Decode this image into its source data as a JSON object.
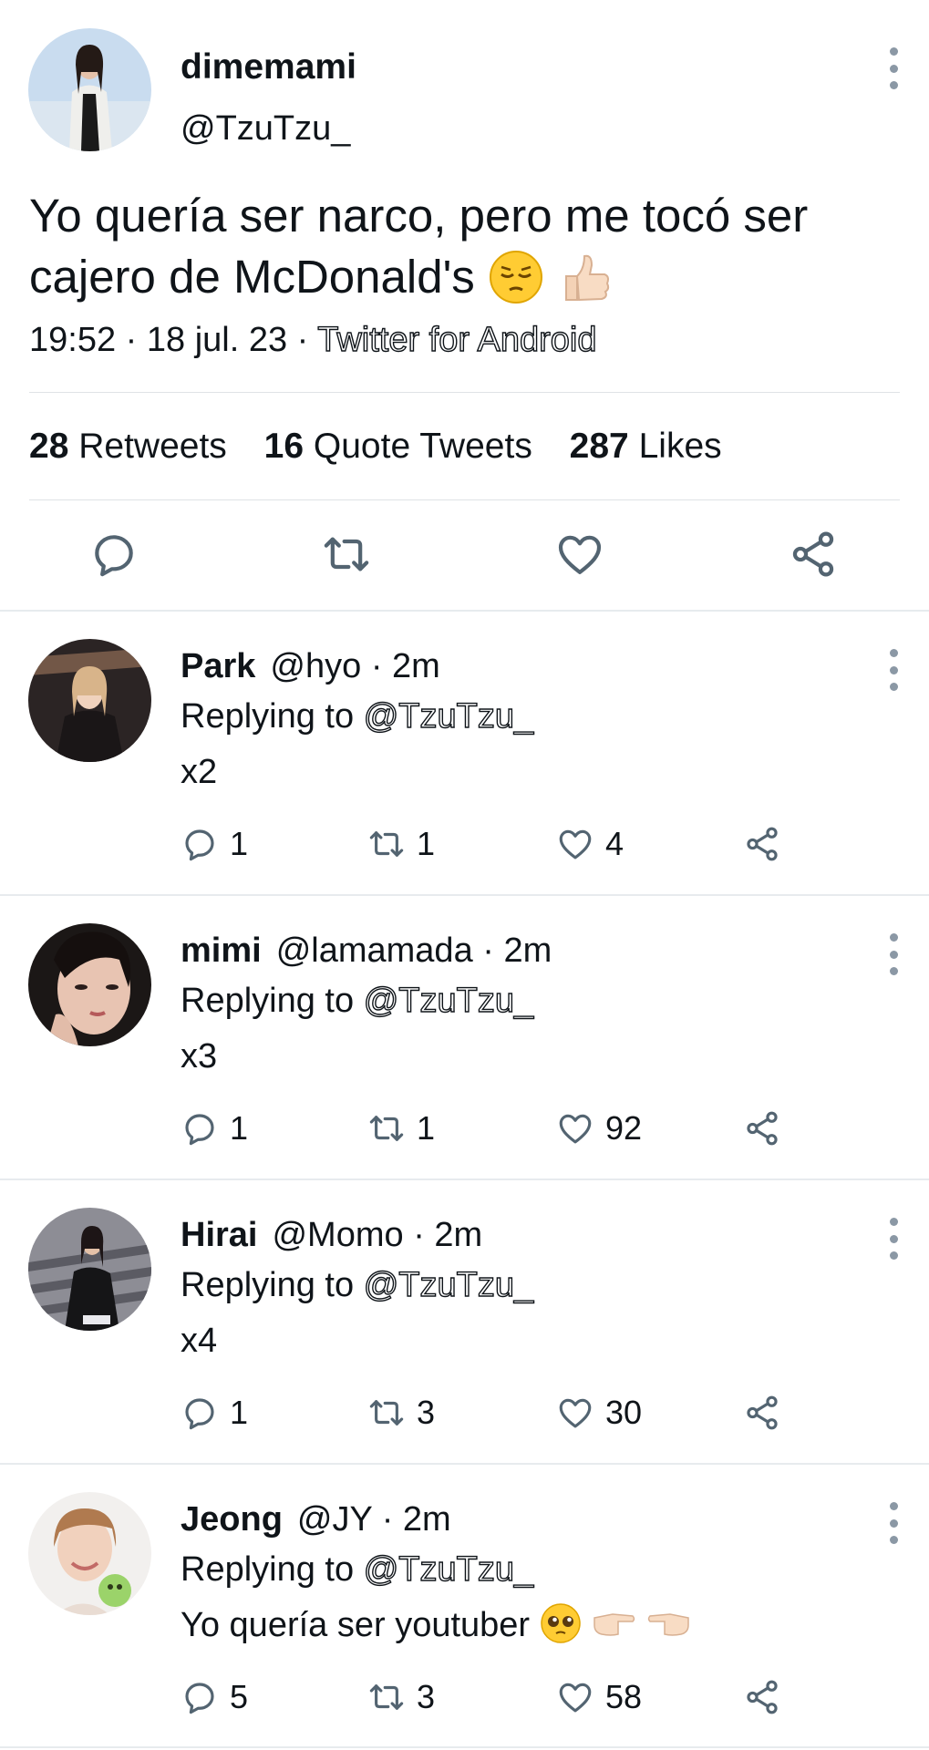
{
  "main_tweet": {
    "display_name": "dimemami",
    "handle": "@TzuTzu_",
    "text": "Yo quería ser narco, pero me tocó ser cajero de McDonald's",
    "time": "19:52",
    "date": "18 jul. 23",
    "source": "Twitter for Android",
    "separator": "·",
    "stats": {
      "retweets_count": "28",
      "retweets_label": "Retweets",
      "quotes_count": "16",
      "quotes_label": "Quote Tweets",
      "likes_count": "287",
      "likes_label": "Likes"
    }
  },
  "replying_label": "Replying to",
  "replies": [
    {
      "name": "Park",
      "handle": "@hyo",
      "age": "· 2m",
      "mention": "@TzuTzu_",
      "text": "x2",
      "replies": "1",
      "retweets": "1",
      "likes": "4"
    },
    {
      "name": "mimi",
      "handle": "@lamamada",
      "age": "· 2m",
      "mention": "@TzuTzu_",
      "text": "x3",
      "replies": "1",
      "retweets": "1",
      "likes": "92"
    },
    {
      "name": "Hirai",
      "handle": "@Momo",
      "age": "· 2m",
      "mention": "@TzuTzu_",
      "text": "x4",
      "replies": "1",
      "retweets": "3",
      "likes": "30"
    },
    {
      "name": "Jeong",
      "handle": "@JY",
      "age": "· 2m",
      "mention": "@TzuTzu_",
      "text": "Yo quería ser youtuber",
      "replies": "5",
      "retweets": "3",
      "likes": "58"
    }
  ],
  "icons": {
    "reply": "reply-bubble-icon",
    "retweet": "retweet-icon",
    "like": "heart-icon",
    "share": "share-icon",
    "more": "more-vertical-icon"
  },
  "colors": {
    "text": "#0f1419",
    "icon": "#536471",
    "divider": "#dfe3e6"
  }
}
